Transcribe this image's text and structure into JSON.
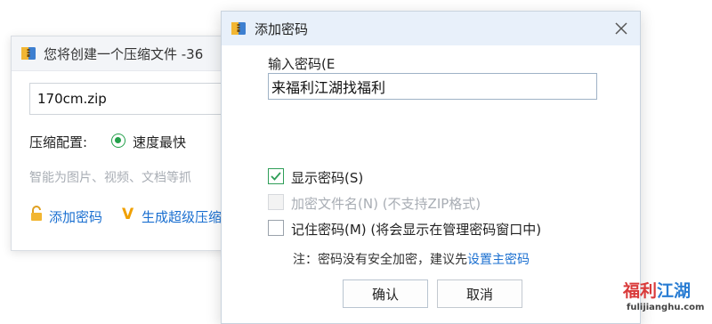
{
  "background_window": {
    "title": "您将创建一个压缩文件 -36",
    "filename": "170cm.zip",
    "config_label": "压缩配置:",
    "config_value": "速度最快",
    "hint": "智能为图片、视频、文档等抓",
    "add_password": "添加密码",
    "super_compress": "生成超级压缩"
  },
  "dialog": {
    "title": "添加密码",
    "password_label": "输入密码(E",
    "password_value": "来福利江湖找福利",
    "options": [
      {
        "label": "显示密码(S)",
        "checked": true,
        "disabled": false
      },
      {
        "label": "加密文件名(N) (不支持ZIP格式)",
        "checked": false,
        "disabled": true
      },
      {
        "label": "记住密码(M) (将会显示在管理密码窗口中)",
        "checked": false,
        "disabled": false
      }
    ],
    "note_prefix": "注：密码没有安全加密，建议先",
    "note_link": "设置主密码",
    "ok_label": "确认",
    "cancel_label": "取消"
  },
  "watermark": {
    "cn_part1": "福利",
    "cn_part2": "江湖",
    "en": "fulijianghu.com"
  },
  "colors": {
    "accent_green": "#2f9e58",
    "link_blue": "#1a6fd0",
    "titlebar": "#e8f0fa"
  }
}
